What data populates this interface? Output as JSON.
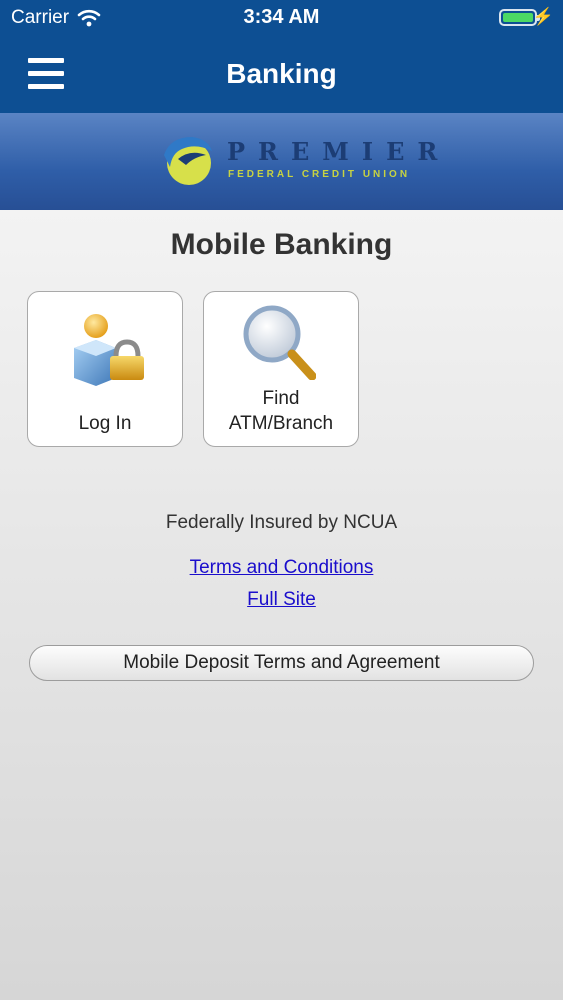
{
  "status_bar": {
    "carrier": "Carrier",
    "time": "3:34 AM",
    "battery_level": 1.0,
    "charging": true
  },
  "nav": {
    "title": "Banking",
    "menu_icon": "hamburger-menu-icon"
  },
  "brand": {
    "logo_name": "PREMIER",
    "logo_tagline": "FEDERAL CREDIT UNION"
  },
  "main": {
    "title": "Mobile Banking",
    "tiles": [
      {
        "label": "Log In",
        "icon": "user-lock-icon"
      },
      {
        "label_line1": "Find",
        "label_line2": "ATM/Branch",
        "icon": "magnifier-icon"
      }
    ],
    "insured_text": "Federally Insured by NCUA",
    "links": {
      "terms": "Terms and Conditions",
      "full_site": "Full Site"
    },
    "deposit_button": "Mobile Deposit Terms and Agreement"
  },
  "colors": {
    "nav_bar": "#0d4f93",
    "link": "#1a0dcc",
    "battery": "#4cd964",
    "logo_accent": "#c7d341"
  }
}
